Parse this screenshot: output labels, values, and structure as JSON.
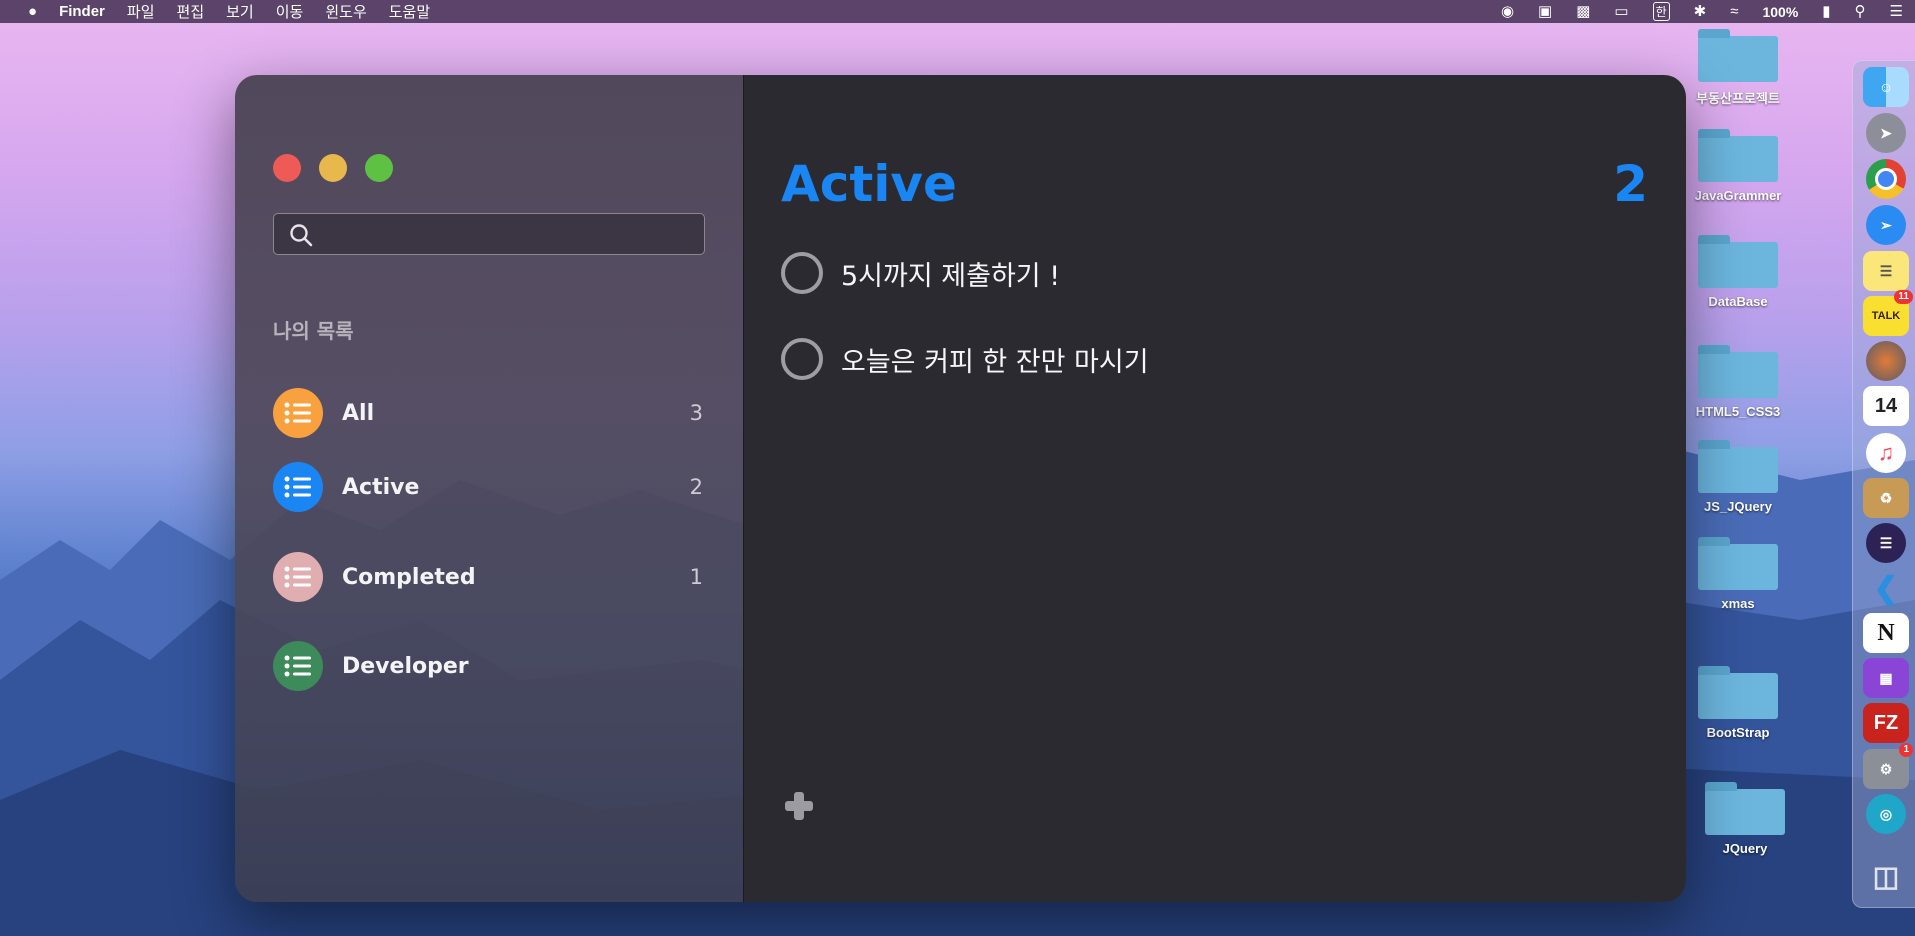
{
  "menubar": {
    "apple": "",
    "app": "Finder",
    "menus": [
      "파일",
      "편집",
      "보기",
      "이동",
      "윈도우",
      "도움말"
    ],
    "status": {
      "battery": "100%",
      "input_method": "한"
    }
  },
  "desktop": {
    "folders": [
      "부동산프로젝트",
      "JavaGrammer",
      "DataBase",
      "HTML5_CSS3",
      "JS_JQuery",
      "xmas",
      "BootStrap",
      "JQuery"
    ]
  },
  "dock": {
    "badges": {
      "kakaotalk": "11",
      "system_preferences": "1"
    },
    "calendar_day": "14",
    "kakao_label": "TALK"
  },
  "sidebar": {
    "search_placeholder": "",
    "section_title": "나의 목록",
    "lists": [
      {
        "label": "All",
        "count": "3",
        "color": "#f9a03f"
      },
      {
        "label": "Active",
        "count": "2",
        "color": "#1a86f4"
      },
      {
        "label": "Completed",
        "count": "1",
        "color": "#e0aeb0"
      },
      {
        "label": "Developer",
        "count": "",
        "color": "#3d8a5a"
      }
    ]
  },
  "main": {
    "title": "Active",
    "title_count": "2",
    "accent_color": "#1a86f4",
    "todos": [
      {
        "text": "5시까지 제출하기 !",
        "done": false
      },
      {
        "text": "오늘은 커피 한 잔만 마시기",
        "done": false
      }
    ],
    "add_icon": "plus-icon"
  }
}
